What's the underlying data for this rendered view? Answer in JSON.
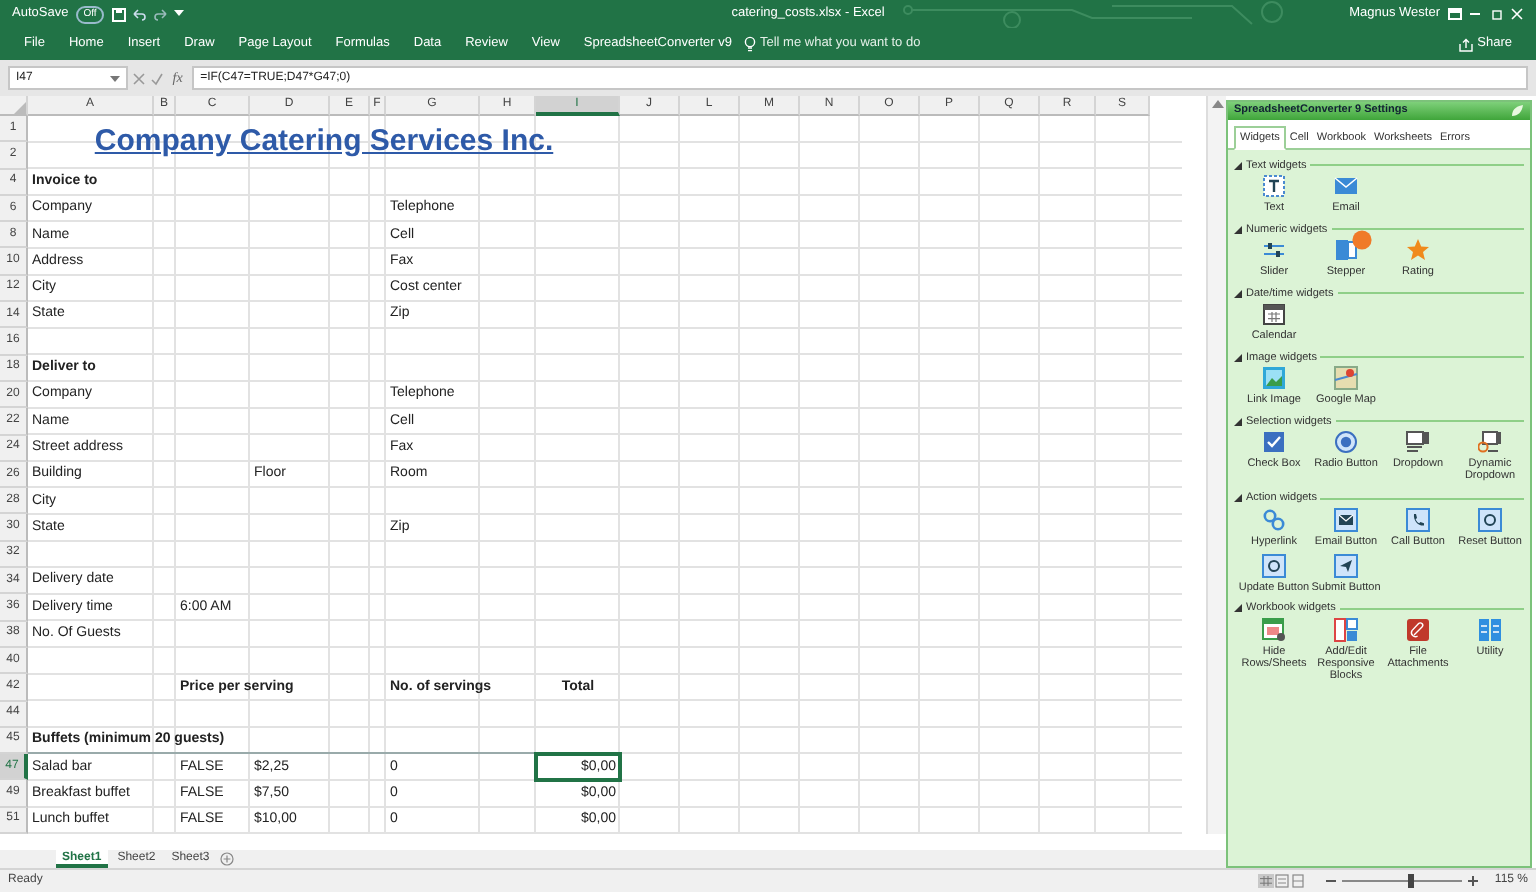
{
  "title_bar": {
    "autosave_label": "AutoSave",
    "autosave_state": "Off",
    "document_title": "catering_costs.xlsx - Excel",
    "user_name": "Magnus Wester"
  },
  "ribbon_tabs": [
    "File",
    "Home",
    "Insert",
    "Draw",
    "Page Layout",
    "Formulas",
    "Data",
    "Review",
    "View",
    "SpreadsheetConverter v9"
  ],
  "tell_me": {
    "placeholder": "Tell me what you want to do"
  },
  "share_label": "Share",
  "formula_bar": {
    "name_box": "I47",
    "function_label": "fx",
    "formula": "=IF(C47=TRUE;D47*G47;0)"
  },
  "columns": [
    "A",
    "B",
    "C",
    "D",
    "E",
    "F",
    "G",
    "H",
    "I",
    "J",
    "L",
    "M",
    "N",
    "O",
    "P",
    "Q",
    "R",
    "S"
  ],
  "rows": [
    {
      "number": "1",
      "kind": "title",
      "a": "Company Catering Services Inc."
    },
    {
      "number": "2",
      "kind": "field"
    },
    {
      "number": "4",
      "kind": "heading",
      "a": "Invoice to"
    },
    {
      "number": "6",
      "kind": "field",
      "a": "Company",
      "g": "Telephone"
    },
    {
      "number": "8",
      "kind": "field",
      "a": "Name",
      "g": "Cell"
    },
    {
      "number": "10",
      "kind": "field",
      "a": "Address",
      "g": "Fax"
    },
    {
      "number": "12",
      "kind": "field",
      "a": "City",
      "g": "Cost center"
    },
    {
      "number": "14",
      "kind": "field",
      "a": "State",
      "g": "Zip"
    },
    {
      "number": "16",
      "kind": "field"
    },
    {
      "number": "18",
      "kind": "heading",
      "a": "Deliver to"
    },
    {
      "number": "20",
      "kind": "field",
      "a": "Company",
      "g": "Telephone"
    },
    {
      "number": "22",
      "kind": "field",
      "a": "Name",
      "g": "Cell"
    },
    {
      "number": "24",
      "kind": "field",
      "a": "Street address",
      "g": "Fax"
    },
    {
      "number": "26",
      "kind": "field",
      "a": "Building",
      "d": "Floor",
      "g": "Room"
    },
    {
      "number": "28",
      "kind": "field",
      "a": "City"
    },
    {
      "number": "30",
      "kind": "field",
      "a": "State",
      "g": "Zip"
    },
    {
      "number": "32",
      "kind": "field"
    },
    {
      "number": "34",
      "kind": "field",
      "a": "Delivery date"
    },
    {
      "number": "36",
      "kind": "field",
      "a": "Delivery time",
      "c": "6:00 AM"
    },
    {
      "number": "38",
      "kind": "field",
      "a": "No. Of Guests"
    },
    {
      "number": "40",
      "kind": "field"
    },
    {
      "number": "42",
      "kind": "header",
      "c": "Price per serving",
      "g": "No. of servings",
      "i": "Total"
    },
    {
      "number": "44",
      "kind": "field"
    },
    {
      "number": "45",
      "kind": "section_heading",
      "a": "Buffets (minimum 20 guests)"
    },
    {
      "number": "47",
      "kind": "item",
      "a": "Salad bar",
      "c": "FALSE",
      "d": "$2,25",
      "g": "0",
      "i": {
        "text": "$0,00",
        "selected": true
      }
    },
    {
      "number": "49",
      "kind": "item",
      "a": "Breakfast buffet",
      "c": "FALSE",
      "d": "$7,50",
      "g": "0",
      "i": {
        "text": "$0,00",
        "selected": false
      }
    },
    {
      "number": "51",
      "kind": "item",
      "a": "Lunch buffet",
      "c": "FALSE",
      "d": "$10,00",
      "g": "0",
      "i": {
        "text": "$0,00",
        "selected": false
      }
    }
  ],
  "sheet_tabs": [
    {
      "label": "Sheet1",
      "selected": true
    },
    {
      "label": "Sheet2",
      "selected": false
    },
    {
      "label": "Sheet3",
      "selected": false
    }
  ],
  "panel": {
    "title": "SpreadsheetConverter 9 Settings",
    "tabs": [
      {
        "label": "Widgets",
        "selected": true
      },
      {
        "label": "Cell",
        "selected": false
      },
      {
        "label": "Workbook",
        "selected": false
      },
      {
        "label": "Worksheets",
        "selected": false
      },
      {
        "label": "Errors",
        "selected": false
      }
    ],
    "sections": [
      {
        "title": "Text widgets",
        "items": [
          {
            "label": "Text",
            "kind": "text",
            "badge": false
          },
          {
            "label": "Email",
            "kind": "email",
            "badge": false
          }
        ]
      },
      {
        "title": "Numeric widgets",
        "items": [
          {
            "label": "Slider",
            "kind": "slider",
            "badge": false
          },
          {
            "label": "Stepper",
            "kind": "stepper",
            "badge": true
          },
          {
            "label": "Rating",
            "kind": "rating",
            "badge": false
          }
        ]
      },
      {
        "title": "Date/time widgets",
        "items": [
          {
            "label": "Calendar",
            "kind": "calendar",
            "badge": false
          }
        ]
      },
      {
        "title": "Image widgets",
        "items": [
          {
            "label": "Link Image",
            "kind": "image",
            "badge": false
          },
          {
            "label": "Google Map",
            "kind": "map",
            "badge": false
          }
        ]
      },
      {
        "title": "Selection widgets",
        "items": [
          {
            "label": "Check Box",
            "kind": "checkbox",
            "badge": false
          },
          {
            "label": "Radio Button",
            "kind": "radio",
            "badge": false
          },
          {
            "label": "Dropdown",
            "kind": "dropdown",
            "badge": false
          },
          {
            "label": "Dynamic Dropdown",
            "kind": "dynamic_dropdown",
            "badge": false
          }
        ]
      },
      {
        "title": "Action widgets",
        "items": [
          {
            "label": "Hyperlink",
            "kind": "hyperlink",
            "badge": false
          },
          {
            "label": "Email Button",
            "kind": "email_button",
            "badge": false
          },
          {
            "label": "Call Button",
            "kind": "call_button",
            "badge": false
          },
          {
            "label": "Reset Button",
            "kind": "reset_button",
            "badge": false
          },
          {
            "label": "Update Button",
            "kind": "update_button",
            "badge": false
          },
          {
            "label": "Submit Button",
            "kind": "submit_button",
            "badge": false
          }
        ]
      },
      {
        "title": "Workbook widgets",
        "items": [
          {
            "label": "Hide Rows/Sheets",
            "kind": "hide",
            "badge": false
          },
          {
            "label": "Add/Edit Responsive Blocks",
            "kind": "blocks",
            "badge": false
          },
          {
            "label": "File Attachments",
            "kind": "attachment",
            "badge": false
          },
          {
            "label": "Utility",
            "kind": "utility",
            "badge": false
          }
        ]
      }
    ]
  },
  "status_bar": {
    "status": "Ready",
    "zoom": {
      "level": 0.55,
      "reading": "115 %"
    }
  }
}
